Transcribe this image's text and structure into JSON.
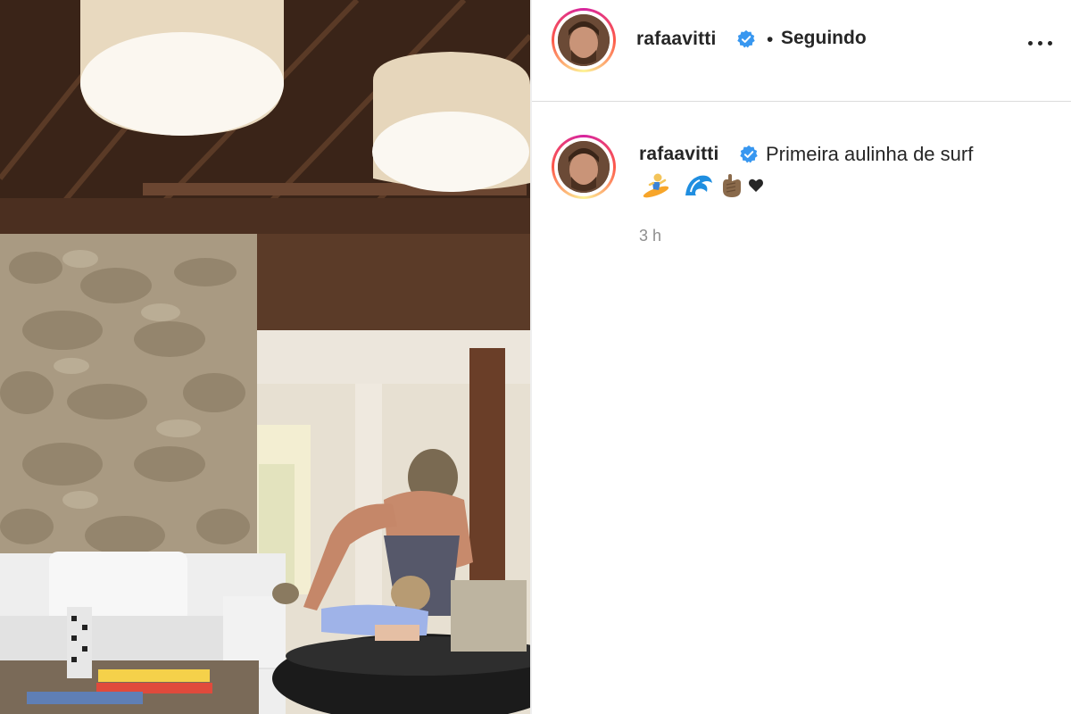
{
  "post": {
    "image_alt": "Adult and toddler practicing surf pose on a board in a living room",
    "header": {
      "username": "rafaavitti",
      "separator": "•",
      "follow_status": "Seguindo"
    },
    "caption": {
      "username": "rafaavitti",
      "text": "Primeira aulinha de surf",
      "emojis": [
        "wave-emoji",
        "surfer-emoji",
        "hand-emoji",
        "heart-emoji"
      ],
      "timestamp": "3 h"
    }
  },
  "colors": {
    "text": "#262626",
    "muted": "#8e8e8e",
    "verified": "#3897f0",
    "divider": "#dbdbdb"
  }
}
